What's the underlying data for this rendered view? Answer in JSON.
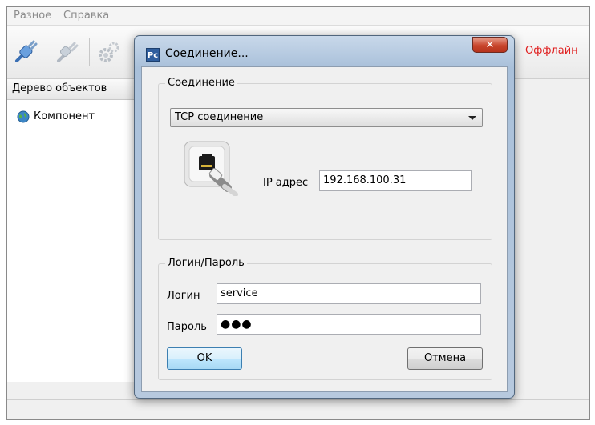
{
  "menu": {
    "items": [
      "Разное",
      "Справка"
    ]
  },
  "toolbar": {
    "icons": [
      "connect-plug-icon",
      "disconnect-plug-icon",
      "settings-gears-icon"
    ]
  },
  "status": {
    "offline": "Оффлайн",
    "offline_color": "#e02020"
  },
  "tree": {
    "header": "Дерево объектов",
    "items": [
      {
        "label": "Компонент",
        "icon": "globe-icon"
      }
    ]
  },
  "dialog": {
    "title": "Соединение...",
    "app_icon_text": "Pc",
    "connection_group": {
      "legend": "Соединение",
      "type_selected": "TCP соединение",
      "ip_label": "IP адрес",
      "ip_value": "192.168.100.31"
    },
    "login_group": {
      "legend": "Логин/Пароль",
      "login_label": "Логин",
      "login_value": "service",
      "password_label": "Пароль",
      "password_mask": "●●●"
    },
    "buttons": {
      "ok": "OK",
      "cancel": "Отмена"
    }
  }
}
